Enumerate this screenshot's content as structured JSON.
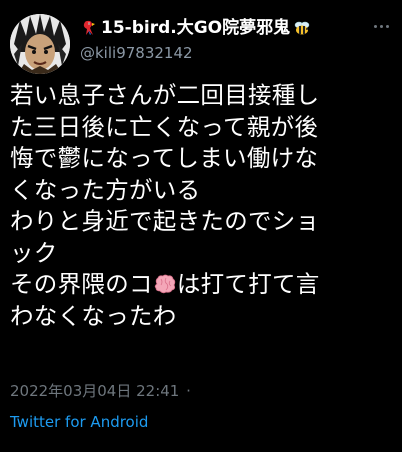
{
  "tweet": {
    "display_name": "15-bird.大GO院夢邪鬼",
    "handle": "@kili97832142",
    "lines": [
      "若い息子さんが二回目接種し",
      "た三日後に亡くなって親が後",
      "悔で鬱になってしまい働けな",
      "くなった方がいる",
      "わりと身近で起きたのでショ",
      "ック",
      "その界隈のコ",
      "は打て打て言",
      "わなくなったわ"
    ],
    "date": "2022年03月04日 22:41",
    "date_dot": "·",
    "source": "Twitter for Android"
  },
  "icons": {
    "avatar": "avatar-illustration",
    "bird": "parrot-emoji",
    "bee": "bee-emoji",
    "brain": "brain-emoji",
    "more": "more-icon"
  },
  "colors": {
    "background": "#000000",
    "text": "#ffffff",
    "secondary": "#6e767d",
    "handle": "#8b98a5",
    "link": "#1d9bf0"
  }
}
